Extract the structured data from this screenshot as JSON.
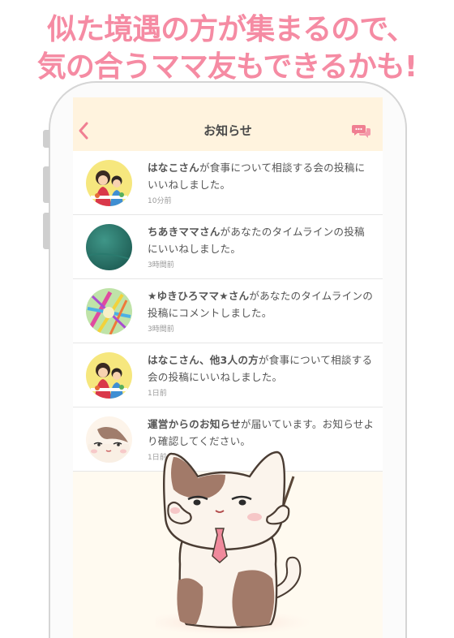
{
  "promo": {
    "line1": "似た境遇の方が集まるので、",
    "line2": "気の合うママ友もできるかも!"
  },
  "colors": {
    "promo": "#f58ba3",
    "accent": "#f07f92",
    "header_bg": "#fff3de"
  },
  "header": {
    "title": "お知らせ",
    "back_icon": "chevron-left-icon",
    "chat_icon": "chat-bubbles-icon"
  },
  "notifications": [
    {
      "name": "はなこさん",
      "text": "が食事について相談する会の投稿にいいねしました。",
      "time": "10分前",
      "avatar": "mother-child-illustration"
    },
    {
      "name": "ちあきママさん",
      "text": "があなたのタイムラインの投稿にいいねしました。",
      "time": "3時間前",
      "avatar": "teal-photo"
    },
    {
      "name": "★ゆきひろママ★さん",
      "text": "があなたのタイムラインの投稿にコメントしました。",
      "time": "3時間前",
      "avatar": "colorful-photo"
    },
    {
      "name": "はなこさん、他3人の方",
      "text": "が食事について相談する会の投稿にいいねしました。",
      "time": "1日前",
      "avatar": "mother-child-illustration"
    },
    {
      "name": "運営からのお知らせ",
      "text": "が届いています。お知らせより確認してください。",
      "time": "1日前",
      "avatar": "cat-mascot"
    }
  ]
}
